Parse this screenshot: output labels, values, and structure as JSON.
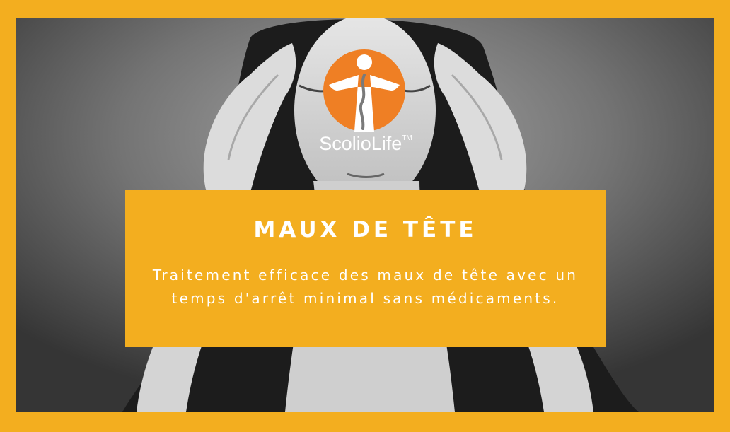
{
  "logo": {
    "brand_name": "ScolioLife",
    "trademark": "TM",
    "icon": "spine-figure-icon"
  },
  "card": {
    "title": "MAUX DE TÊTE",
    "description": "Traitement efficace des maux de tête avec un temps d'arrêt minimal sans médicaments."
  },
  "colors": {
    "border": "#f3ae1f",
    "card_bg": "#f3ae1f",
    "logo_orange": "#ef7f24",
    "text": "#ffffff"
  }
}
